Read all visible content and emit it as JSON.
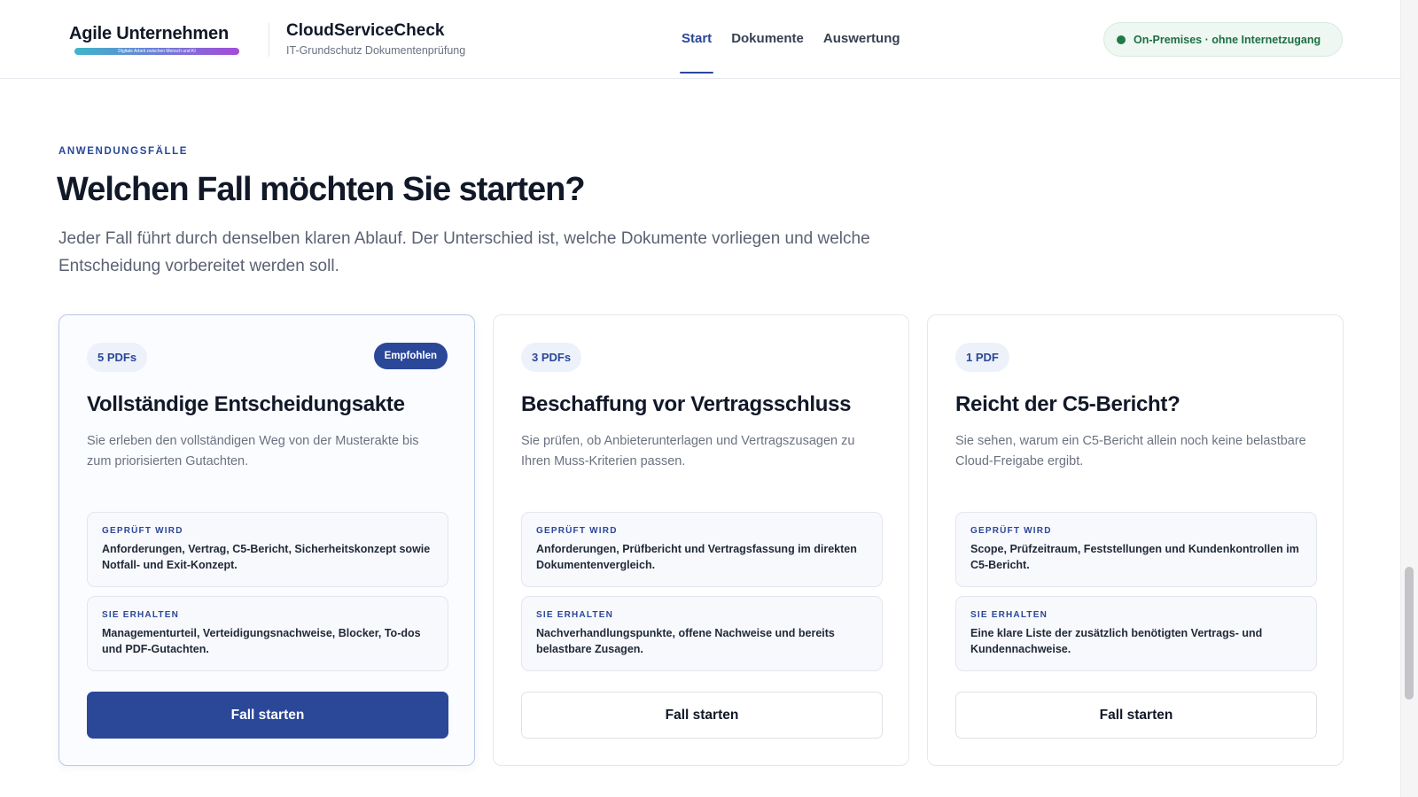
{
  "header": {
    "brand_name": "Agile Unternehmen",
    "brand_tagline": "Digitale Arbeit zwischen Mensch und KI",
    "product_title": "CloudServiceCheck",
    "product_subtitle": "IT-Grundschutz Dokumentenprüfung",
    "nav": [
      "Start",
      "Dokumente",
      "Auswertung"
    ],
    "active_nav": "Start",
    "status": "On-Premises · ohne Internetzugang",
    "status_color": "#1f7a46"
  },
  "hero": {
    "eyebrow": "ANWENDUNGSFÄLLE",
    "title": "Welchen Fall möchten Sie starten?",
    "lead": "Jeder Fall führt durch denselben klaren Ablauf. Der Unterschied ist, welche Dokumente vorliegen und welche Entscheidung vorbereitet werden soll."
  },
  "accent_color": "#2a4798",
  "cards": [
    {
      "chip": "5 PDFs",
      "badge": "Empfohlen",
      "title": "Vollständige Entscheidungsakte",
      "description": "Sie erleben den vollständigen Weg von der Musterakte bis zum priorisierten Gutachten.",
      "checked_label": "GEPRÜFT WIRD",
      "checked_text": "Anforderungen, Vertrag, C5-Bericht, Sicherheitskonzept sowie Notfall- und Exit-Konzept.",
      "result_label": "SIE ERHALTEN",
      "result_text": "Managementurteil, Verteidigungsnachweise, Blocker, To-dos und PDF-Gutachten.",
      "button": "Fall starten"
    },
    {
      "chip": "3 PDFs",
      "title": "Beschaffung vor Vertragsschluss",
      "description": "Sie prüfen, ob Anbieterunterlagen und Vertragszusagen zu Ihren Muss-Kriterien passen.",
      "checked_label": "GEPRÜFT WIRD",
      "checked_text": "Anforderungen, Prüfbericht und Vertragsfassung im direkten Dokumentenvergleich.",
      "result_label": "SIE ERHALTEN",
      "result_text": "Nachverhandlungspunkte, offene Nachweise und bereits belastbare Zusagen.",
      "button": "Fall starten"
    },
    {
      "chip": "1 PDF",
      "title": "Reicht der C5-Bericht?",
      "description": "Sie sehen, warum ein C5-Bericht allein noch keine belastbare Cloud-Freigabe ergibt.",
      "checked_label": "GEPRÜFT WIRD",
      "checked_text": "Scope, Prüfzeitraum, Feststellungen und Kundenkontrollen im C5-Bericht.",
      "result_label": "SIE ERHALTEN",
      "result_text": "Eine klare Liste der zusätzlich benötigten Vertrags- und Kundennachweise.",
      "button": "Fall starten"
    }
  ]
}
